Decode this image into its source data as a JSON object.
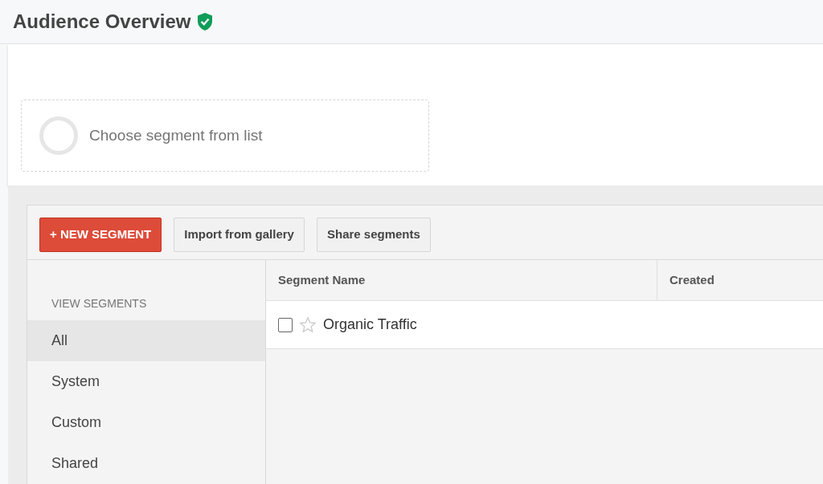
{
  "header": {
    "title": "Audience Overview",
    "verified": true
  },
  "segment_slot": {
    "label": "Choose segment from list"
  },
  "toolbar": {
    "buttons": [
      {
        "label": "+ NEW SEGMENT",
        "kind": "primary"
      },
      {
        "label": "Import from gallery",
        "kind": "secondary"
      },
      {
        "label": "Share segments",
        "kind": "secondary"
      }
    ]
  },
  "sidebar": {
    "heading": "VIEW SEGMENTS",
    "items": [
      {
        "label": "All",
        "selected": true
      },
      {
        "label": "System",
        "selected": false
      },
      {
        "label": "Custom",
        "selected": false
      },
      {
        "label": "Shared",
        "selected": false
      }
    ]
  },
  "table": {
    "columns": [
      "Segment Name",
      "Created"
    ],
    "rows": [
      {
        "name": "Organic Traffic",
        "checked": false,
        "starred": false
      }
    ]
  }
}
